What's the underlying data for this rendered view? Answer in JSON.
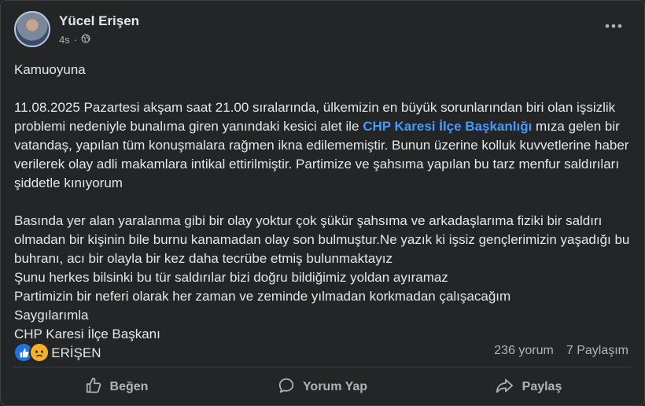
{
  "post": {
    "author": "Yücel Erişen",
    "time": "4s",
    "title_line": "Kamuoyuna",
    "para1_before_link": "11.08.2025 Pazartesi akşam saat 21.00 sıralarında, ülkemizin en büyük sorunlarından biri olan işsizlik problemi nedeniyle bunalıma giren yanındaki kesici alet ile ",
    "para1_link": "CHP Karesi İlçe Başkanlığı",
    "para1_after_link": " mıza gelen bir vatandaş, yapılan tüm konuşmalara rağmen ikna edilememiştir. Bunun üzerine kolluk kuvvetlerine haber verilerek olay adli makamlara intikal ettirilmiştir. Partimize ve şahsıma yapılan bu tarz menfur saldırıları şiddetle kınıyorum",
    "para2": [
      "Basında yer alan  yaralanma gibi bir olay yoktur çok şükür şahsıma ve arkadaşlarıma fiziki bir saldırı olmadan bir kişinin bile burnu kanamadan olay son bulmuştur.Ne yazık ki işsiz gençlerimizin yaşadığı bu buhranı, acı bir olayla bir kez daha tecrübe etmiş bulunmaktayız",
      "Şunu herkes bilsinki bu tür saldırılar bizi doğru bildiğimiz yoldan ayıramaz",
      "Partimizin bir neferi olarak her zaman ve zeminde yılmadan korkmadan çalışacağım",
      "Saygılarımla",
      "CHP Karesi İlçe Başkanı",
      "Yücel ERİŞEN"
    ]
  },
  "stats": {
    "comments": "236 yorum",
    "shares": "7 Paylaşım"
  },
  "actions": {
    "like": "Beğen",
    "comment": "Yorum Yap",
    "share": "Paylaş"
  },
  "icons": [
    "globe-icon",
    "more-options-icon",
    "like-reaction-icon",
    "sad-reaction-icon",
    "thumbs-up-icon",
    "comment-bubble-icon",
    "share-arrow-icon"
  ],
  "colors": {
    "background": "#242526",
    "text": "#e4e6eb",
    "secondary_text": "#b0b3b8",
    "link": "#4599ff",
    "like_blue": "#1b74e4",
    "sad_yellow": "#f7b125"
  }
}
